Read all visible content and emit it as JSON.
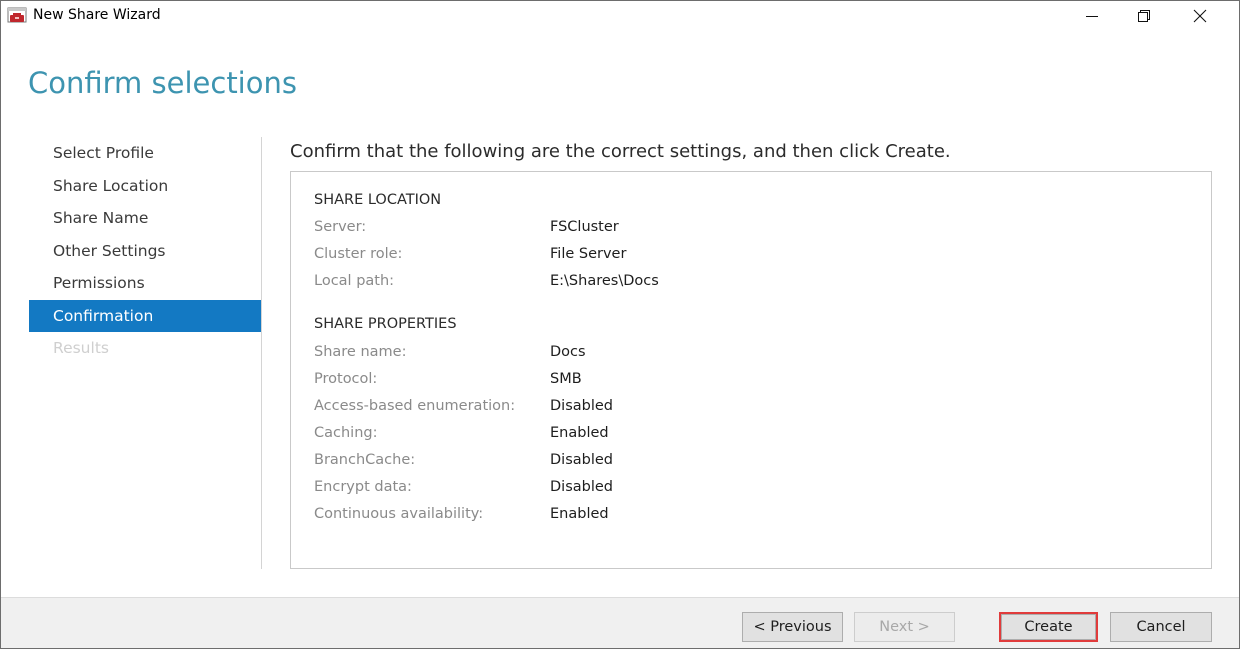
{
  "window": {
    "title": "New Share Wizard"
  },
  "page": {
    "title": "Confirm selections",
    "instruction": "Confirm that the following are the correct settings, and then click Create."
  },
  "nav": {
    "items": [
      {
        "label": "Select Profile",
        "state": "normal"
      },
      {
        "label": "Share Location",
        "state": "normal"
      },
      {
        "label": "Share Name",
        "state": "normal"
      },
      {
        "label": "Other Settings",
        "state": "normal"
      },
      {
        "label": "Permissions",
        "state": "normal"
      },
      {
        "label": "Confirmation",
        "state": "active"
      },
      {
        "label": "Results",
        "state": "disabled"
      }
    ]
  },
  "share_location": {
    "heading": "SHARE LOCATION",
    "rows": [
      {
        "label": "Server:",
        "value": "FSCluster"
      },
      {
        "label": "Cluster role:",
        "value": "File Server"
      },
      {
        "label": "Local path:",
        "value": "E:\\Shares\\Docs"
      }
    ]
  },
  "share_properties": {
    "heading": "SHARE PROPERTIES",
    "rows": [
      {
        "label": "Share name:",
        "value": "Docs"
      },
      {
        "label": "Protocol:",
        "value": "SMB"
      },
      {
        "label": "Access-based enumeration:",
        "value": "Disabled"
      },
      {
        "label": "Caching:",
        "value": "Enabled"
      },
      {
        "label": "BranchCache:",
        "value": "Disabled"
      },
      {
        "label": "Encrypt data:",
        "value": "Disabled"
      },
      {
        "label": "Continuous availability:",
        "value": "Enabled"
      }
    ]
  },
  "footer": {
    "previous_label": "< Previous",
    "next_label": "Next >",
    "create_label": "Create",
    "cancel_label": "Cancel"
  },
  "colors": {
    "title_accent": "#3d94b0",
    "nav_active": "#1379c3",
    "highlight_border": "#e03b3b"
  },
  "icons": {
    "app": "share-wizard-icon",
    "minimize": "minimize-icon",
    "maximize": "restore-icon",
    "close": "close-icon"
  }
}
